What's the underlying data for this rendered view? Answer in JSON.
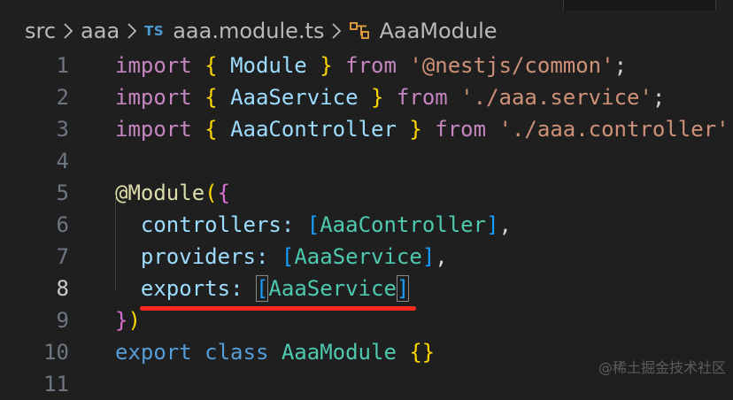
{
  "breadcrumb": {
    "items": [
      "src",
      "aaa",
      "aaa.module.ts",
      "AaaModule"
    ],
    "file_icon": "TS"
  },
  "editor": {
    "active_line": 8,
    "lines": [
      {
        "n": "1",
        "tokens": [
          [
            "kw",
            "import"
          ],
          [
            "punc",
            " "
          ],
          [
            "b1",
            "{"
          ],
          [
            "punc",
            " "
          ],
          [
            "id",
            "Module"
          ],
          [
            "punc",
            " "
          ],
          [
            "b1",
            "}"
          ],
          [
            "punc",
            " "
          ],
          [
            "kw",
            "from"
          ],
          [
            "punc",
            " "
          ],
          [
            "str",
            "'@nestjs/common'"
          ],
          [
            "punc",
            ";"
          ]
        ]
      },
      {
        "n": "2",
        "tokens": [
          [
            "kw",
            "import"
          ],
          [
            "punc",
            " "
          ],
          [
            "b1",
            "{"
          ],
          [
            "punc",
            " "
          ],
          [
            "id",
            "AaaService"
          ],
          [
            "punc",
            " "
          ],
          [
            "b1",
            "}"
          ],
          [
            "punc",
            " "
          ],
          [
            "kw",
            "from"
          ],
          [
            "punc",
            " "
          ],
          [
            "str",
            "'./aaa.service'"
          ],
          [
            "punc",
            ";"
          ]
        ]
      },
      {
        "n": "3",
        "tokens": [
          [
            "kw",
            "import"
          ],
          [
            "punc",
            " "
          ],
          [
            "b1",
            "{"
          ],
          [
            "punc",
            " "
          ],
          [
            "id",
            "AaaController"
          ],
          [
            "punc",
            " "
          ],
          [
            "b1",
            "}"
          ],
          [
            "punc",
            " "
          ],
          [
            "kw",
            "from"
          ],
          [
            "punc",
            " "
          ],
          [
            "str",
            "'./aaa.controller'"
          ],
          [
            "punc",
            ";"
          ]
        ]
      },
      {
        "n": "4",
        "tokens": []
      },
      {
        "n": "5",
        "tokens": [
          [
            "dec",
            "@Module"
          ],
          [
            "b1",
            "("
          ],
          [
            "b2",
            "{"
          ]
        ]
      },
      {
        "n": "6",
        "tokens": [
          [
            "punc",
            "  "
          ],
          [
            "id",
            "controllers"
          ],
          [
            "id",
            ":"
          ],
          [
            "punc",
            " "
          ],
          [
            "b3",
            "["
          ],
          [
            "cls",
            "AaaController"
          ],
          [
            "b3",
            "]"
          ],
          [
            "punc",
            ","
          ]
        ]
      },
      {
        "n": "7",
        "tokens": [
          [
            "punc",
            "  "
          ],
          [
            "id",
            "providers"
          ],
          [
            "id",
            ":"
          ],
          [
            "punc",
            " "
          ],
          [
            "b3",
            "["
          ],
          [
            "cls",
            "AaaService"
          ],
          [
            "b3",
            "]"
          ],
          [
            "punc",
            ","
          ]
        ]
      },
      {
        "n": "8",
        "tokens": [
          [
            "punc",
            "  "
          ],
          [
            "id",
            "exports"
          ],
          [
            "id",
            ":"
          ],
          [
            "punc",
            " "
          ],
          [
            "b3",
            "["
          ],
          [
            "cls",
            "AaaService"
          ],
          [
            "b3",
            "]"
          ]
        ]
      },
      {
        "n": "9",
        "tokens": [
          [
            "b2",
            "}"
          ],
          [
            "b1",
            ")"
          ]
        ]
      },
      {
        "n": "10",
        "tokens": [
          [
            "kw2",
            "export"
          ],
          [
            "punc",
            " "
          ],
          [
            "kw2",
            "class"
          ],
          [
            "punc",
            " "
          ],
          [
            "cls",
            "AaaModule"
          ],
          [
            "punc",
            " "
          ],
          [
            "b1",
            "{}"
          ]
        ]
      },
      {
        "n": "11",
        "tokens": []
      }
    ]
  },
  "watermark": "@稀土掘金技术社区",
  "colors": {
    "background": "#1f1f1f",
    "keyword": "#c586c0",
    "string": "#ce9178",
    "identifier": "#9cdcfe",
    "class": "#4ec9b0",
    "annotation_underline": "#ff2a1a"
  }
}
